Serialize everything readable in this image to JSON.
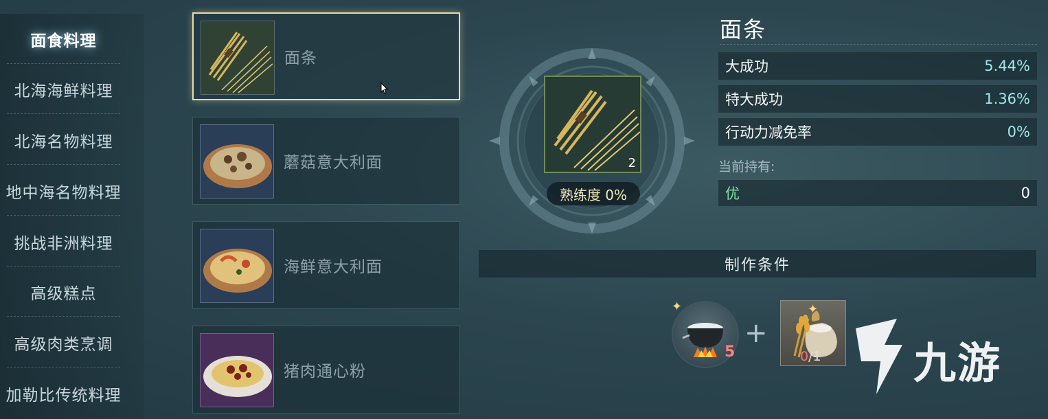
{
  "sidebar": {
    "categories": [
      {
        "label": "面食料理",
        "active": true
      },
      {
        "label": "北海海鲜料理"
      },
      {
        "label": "北海名物料理"
      },
      {
        "label": "地中海名物料理"
      },
      {
        "label": "挑战非洲料理"
      },
      {
        "label": "高级糕点"
      },
      {
        "label": "高级肉类烹调"
      },
      {
        "label": "加勒比传统料理"
      }
    ]
  },
  "recipes": [
    {
      "name": "面条",
      "selected": true,
      "icon": "noodle-bundle-icon"
    },
    {
      "name": "蘑菇意大利面",
      "icon": "mushroom-pasta-icon"
    },
    {
      "name": "海鲜意大利面",
      "icon": "seafood-pasta-icon"
    },
    {
      "name": "猪肉通心粉",
      "icon": "pork-macaroni-icon"
    }
  ],
  "detail": {
    "item_count": "2",
    "proficiency": "熟练度 0%",
    "title": "面条",
    "stats": [
      {
        "label": "大成功",
        "value": "5.44%"
      },
      {
        "label": "特大成功",
        "value": "1.36%"
      },
      {
        "label": "行动力减免率",
        "value": "0%"
      }
    ],
    "owned_label": "当前持有:",
    "owned": {
      "quality": "优",
      "count": "0"
    }
  },
  "crafting": {
    "header": "制作条件",
    "tool_level": "5",
    "plus": "+",
    "material_have": "0",
    "material_need": "/1"
  },
  "watermark": {
    "text": "九游"
  },
  "colors": {
    "accent": "#e8dca2",
    "stat_value": "#9ee9ea",
    "quality": "#7fe0a0",
    "warn": "#ff6f6f"
  }
}
